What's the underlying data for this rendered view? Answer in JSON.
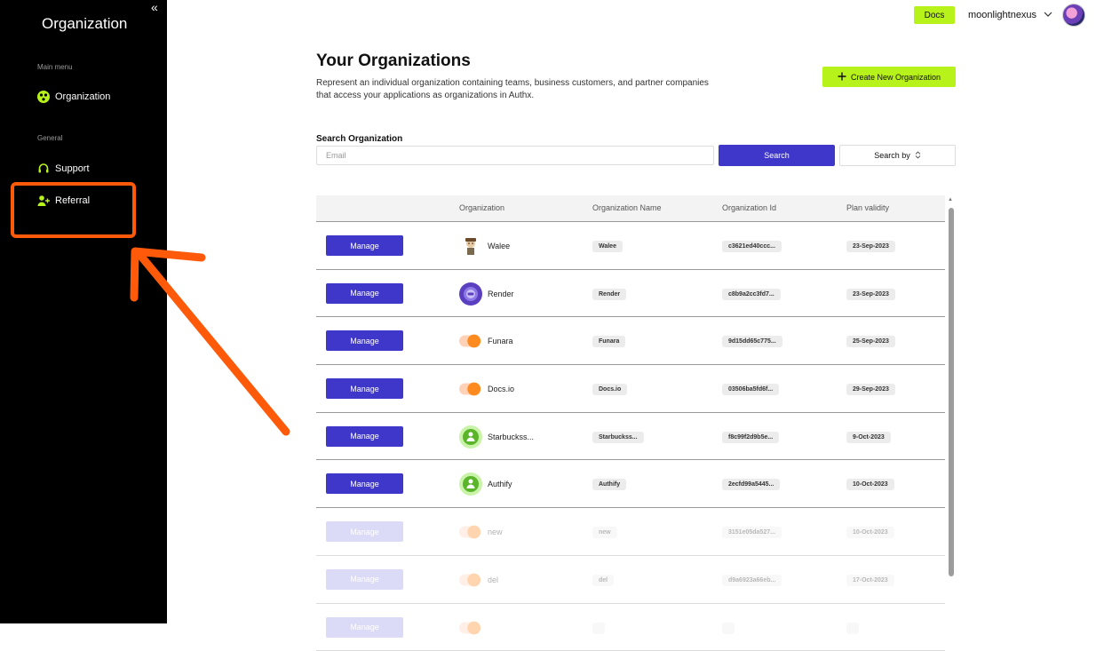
{
  "sidebar": {
    "title": "Organization",
    "collapse_icon": "double-chevron-left-icon",
    "sections": [
      {
        "label": "Main menu"
      },
      {
        "label": "General"
      }
    ],
    "items": [
      {
        "label": "Organization",
        "icon": "organization-icon"
      },
      {
        "label": "Support",
        "icon": "headset-icon"
      },
      {
        "label": "Referral",
        "icon": "add-user-icon"
      }
    ],
    "icon_color": "#b7f21a"
  },
  "topbar": {
    "docs_label": "Docs",
    "username": "moonlightnexus"
  },
  "main": {
    "title": "Your Organizations",
    "description": "Represent an individual organization containing teams, business customers, and partner companies that access your applications as organizations in Authx.",
    "create_label": "Create New Organization",
    "search_label": "Search Organization",
    "search_placeholder": "Email",
    "search_button": "Search",
    "search_by_label": "Search by"
  },
  "table": {
    "headers": [
      "Organization",
      "Organization Name",
      "Organization Id",
      "Plan validity"
    ],
    "manage_label": "Manage",
    "rows": [
      {
        "org": "Walee",
        "name": "Walee",
        "id": "c3621ed40ccc...",
        "validity": "23-Sep-2023",
        "logo": "walee",
        "disabled": false
      },
      {
        "org": "Render",
        "name": "Render",
        "id": "c8b9a2cc3fd7...",
        "validity": "23-Sep-2023",
        "logo": "render",
        "disabled": false
      },
      {
        "org": "Funara",
        "name": "Funara",
        "id": "9d15dd65c775...",
        "validity": "25-Sep-2023",
        "logo": "toggle",
        "disabled": false
      },
      {
        "org": "Docs.io",
        "name": "Docs.io",
        "id": "03506ba5fd6f...",
        "validity": "29-Sep-2023",
        "logo": "toggle",
        "disabled": false
      },
      {
        "org": "Starbuckss...",
        "name": "Starbuckss...",
        "id": "f8c99f2d9b5e...",
        "validity": "9-Oct-2023",
        "logo": "person",
        "disabled": false
      },
      {
        "org": "Authify",
        "name": "Authify",
        "id": "2ecfd99a5445...",
        "validity": "10-Oct-2023",
        "logo": "person",
        "disabled": false
      },
      {
        "org": "new",
        "name": "new",
        "id": "3151e05da527...",
        "validity": "10-Oct-2023",
        "logo": "toggle",
        "disabled": true
      },
      {
        "org": "del",
        "name": "del",
        "id": "d9a6923a66eb...",
        "validity": "17-Oct-2023",
        "logo": "toggle",
        "disabled": true
      },
      {
        "org": "",
        "name": "",
        "id": "",
        "validity": "",
        "logo": "toggle",
        "disabled": true
      }
    ]
  },
  "colors": {
    "accent_green": "#b7f21a",
    "primary_purple": "#3f37c9",
    "annotation_orange": "#ff5a0a"
  }
}
